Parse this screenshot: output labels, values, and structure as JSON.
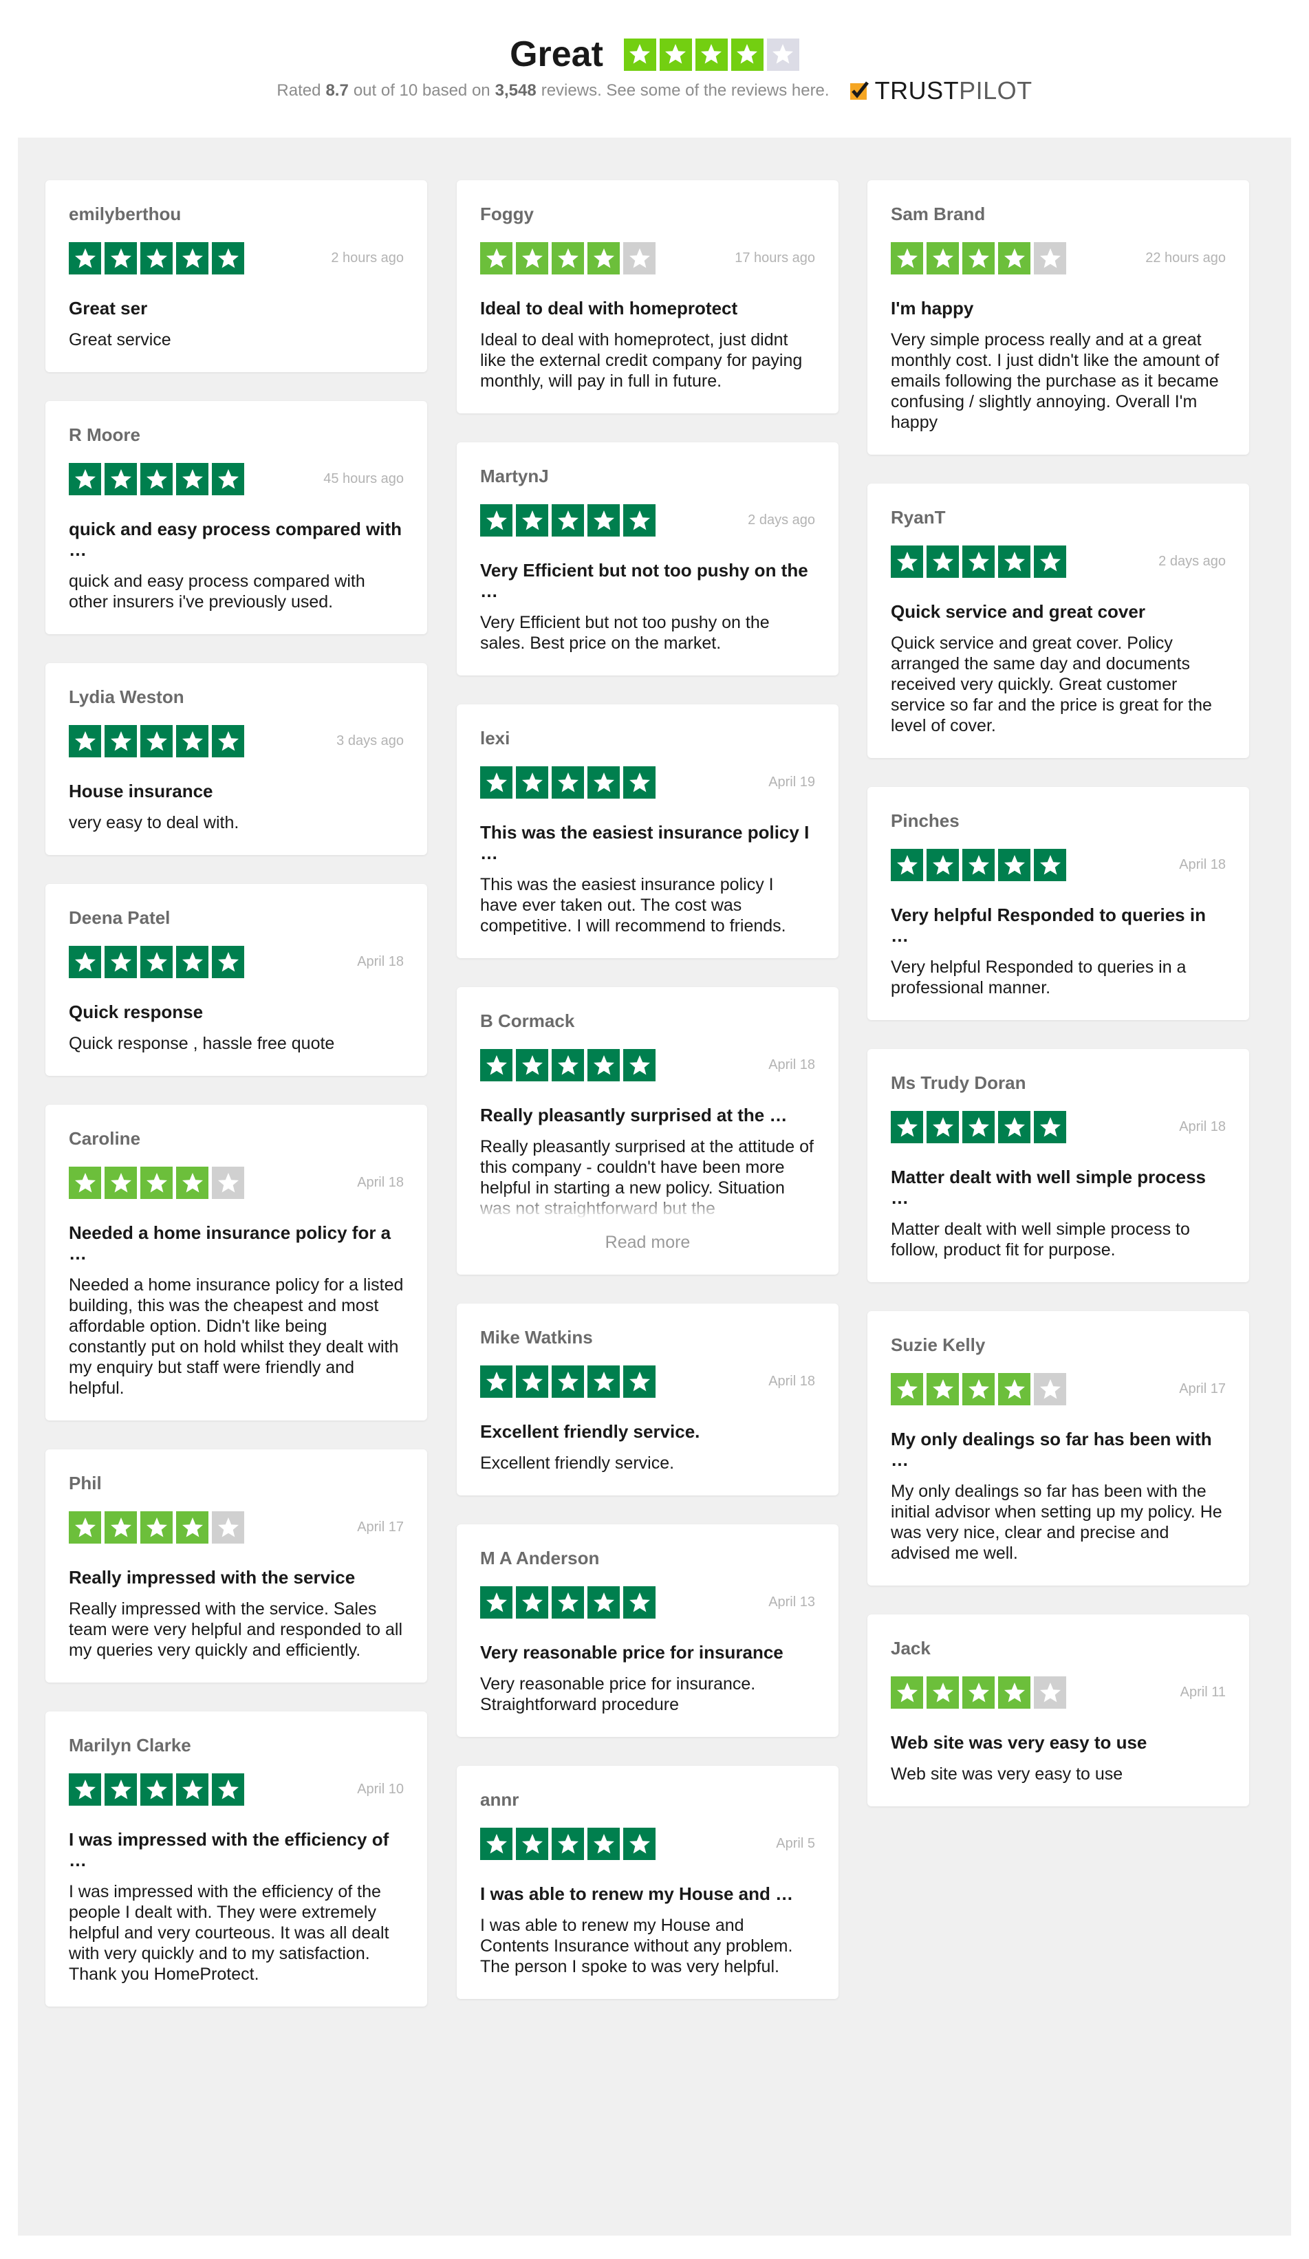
{
  "header": {
    "rating_word": "Great",
    "summary_prefix": "Rated",
    "score": "8.7",
    "summary_mid": "out of 10 based on",
    "review_count": "3,548",
    "summary_suffix": "reviews. See some of the reviews here.",
    "brand_trust": "TRUST",
    "brand_pilot": "PILOT",
    "overall_stars": 4
  },
  "colors": {
    "five_star": "#007f4e",
    "four_star": "#6cbf3b",
    "empty_star": "#d0d0d0",
    "panel_bg": "#f0f0f0"
  },
  "read_more_label": "Read more",
  "columns": [
    [
      {
        "name": "emilyberthou",
        "date": "2 hours ago",
        "stars": 5,
        "title": "Great ser",
        "body": "Great service"
      },
      {
        "name": "R Moore",
        "date": "45 hours ago",
        "stars": 5,
        "title": "quick and easy process compared with …",
        "body": "quick and easy process compared with other insurers i've previously used."
      },
      {
        "name": "Lydia Weston",
        "date": "3 days ago",
        "stars": 5,
        "title": "House insurance",
        "body": "very easy to deal with."
      },
      {
        "name": "Deena Patel",
        "date": "April 18",
        "stars": 5,
        "title": "Quick response",
        "body": "Quick response , hassle free quote"
      },
      {
        "name": "Caroline",
        "date": "April 18",
        "stars": 4,
        "title": "Needed a home insurance policy for a …",
        "body": "Needed a home insurance policy for a listed building, this was the cheapest and most affordable option. Didn't like being constantly put on hold whilst they dealt with my enquiry but staff were friendly and helpful."
      },
      {
        "name": "Phil",
        "date": "April 17",
        "stars": 4,
        "title": "Really impressed with the service",
        "body": "Really impressed with the service. Sales team were very helpful and responded to all my queries very quickly and efficiently."
      },
      {
        "name": "Marilyn Clarke",
        "date": "April 10",
        "stars": 5,
        "title": "I was impressed with the efficiency of …",
        "body": "I was impressed with the efficiency of the people I dealt with. They were extremely helpful and very courteous. It was all dealt with very quickly and to my satisfaction.\nThank you HomeProtect."
      }
    ],
    [
      {
        "name": "Foggy",
        "date": "17 hours ago",
        "stars": 4,
        "title": "Ideal to deal with homeprotect",
        "body": "Ideal to deal with homeprotect, just didnt like the external credit company for paying monthly, will pay in full in future."
      },
      {
        "name": "MartynJ",
        "date": "2 days ago",
        "stars": 5,
        "title": "Very Efficient but not too pushy on the …",
        "body": "Very Efficient but not too pushy on the sales. Best price on the market."
      },
      {
        "name": "lexi",
        "date": "April 19",
        "stars": 5,
        "title": "This was the easiest insurance policy I …",
        "body": "This was the easiest insurance policy I have ever taken out. The cost was competitive. I will recommend to friends."
      },
      {
        "name": "B Cormack",
        "date": "April 18",
        "stars": 5,
        "title": "Really pleasantly surprised at the …",
        "body": "Really pleasantly surprised at the attitude of this company - couldn't have been more helpful in starting a new policy. Situation was not straightforward but the",
        "truncated": true
      },
      {
        "name": "Mike Watkins",
        "date": "April 18",
        "stars": 5,
        "title": "Excellent friendly service.",
        "body": "Excellent friendly service."
      },
      {
        "name": "M A Anderson",
        "date": "April 13",
        "stars": 5,
        "title": "Very reasonable price for insurance",
        "body": "Very reasonable price for insurance. Straightforward procedure"
      },
      {
        "name": "annr",
        "date": "April 5",
        "stars": 5,
        "title": "I was able to renew my House and …",
        "body": "I was able to renew my House and Contents Insurance without any problem. The person I spoke to was very helpful."
      }
    ],
    [
      {
        "name": "Sam Brand",
        "date": "22 hours ago",
        "stars": 4,
        "title": "I'm happy",
        "body": "Very simple process really and at a great monthly cost. I just didn't like the amount of emails following the purchase as it became confusing / slightly annoying. Overall I'm happy"
      },
      {
        "name": "RyanT",
        "date": "2 days ago",
        "stars": 5,
        "title": "Quick service and great cover",
        "body": "Quick service and great cover. Policy arranged the same day and documents received very quickly. Great customer service so far and the price is great for the level of cover."
      },
      {
        "name": "Pinches",
        "date": "April 18",
        "stars": 5,
        "title": "Very helpful Responded to queries in …",
        "body": "Very helpful Responded to queries in a professional manner."
      },
      {
        "name": "Ms Trudy Doran",
        "date": "April 18",
        "stars": 5,
        "title": "Matter dealt with well simple process …",
        "body": "Matter dealt with well simple process to follow, product fit for purpose."
      },
      {
        "name": "Suzie Kelly",
        "date": "April 17",
        "stars": 4,
        "title": "My only dealings so far has been with …",
        "body": "My only dealings so far has been with the initial advisor when setting up my policy. He was very nice, clear and precise and advised me well."
      },
      {
        "name": "Jack",
        "date": "April 11",
        "stars": 4,
        "title": "Web site was very easy to use",
        "body": "Web site was very easy to use"
      }
    ]
  ]
}
